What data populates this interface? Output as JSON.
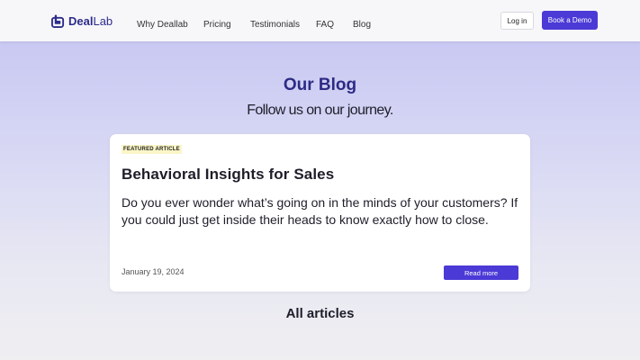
{
  "brand": {
    "name_bold": "Deal",
    "name_light": "Lab",
    "color": "#2d2c8a"
  },
  "nav": {
    "items": [
      {
        "label": "Why Deallab"
      },
      {
        "label": "Pricing"
      },
      {
        "label": "Testimonials"
      },
      {
        "label": "FAQ"
      },
      {
        "label": "Blog"
      }
    ],
    "login_label": "Log in",
    "demo_label": "Book a Demo",
    "accent": "#4b3ad6"
  },
  "hero": {
    "title": "Our Blog",
    "subtitle": "Follow us on our journey."
  },
  "featured": {
    "badge": "FEATURED ARTICLE",
    "title": "Behavioral Insights for Sales",
    "excerpt": "Do you ever wonder what’s going on in the minds of your customers? If you could just get inside their heads to know exactly how to close.",
    "date": "January 19, 2024",
    "read_more_label": "Read more"
  },
  "sections": {
    "all_articles_title": "All articles"
  }
}
